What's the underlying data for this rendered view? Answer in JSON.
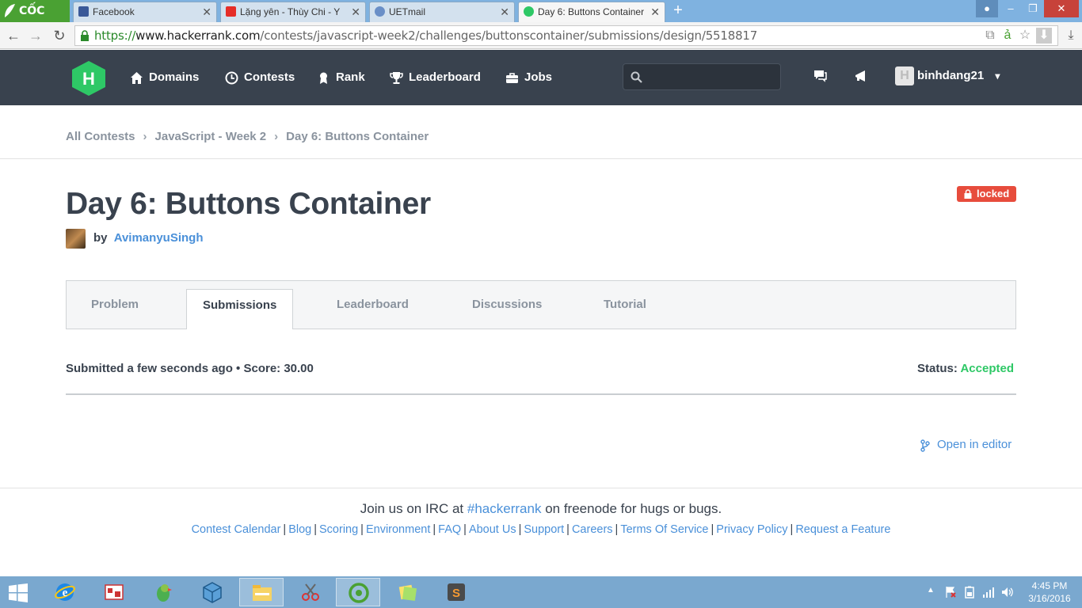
{
  "browser": {
    "brand": "CỐC CỐC",
    "tabs": [
      {
        "title": "Facebook",
        "icon": "facebook-icon"
      },
      {
        "title": "Lặng yên - Thùy Chi - Y",
        "icon": "youtube-icon"
      },
      {
        "title": "UETmail",
        "icon": "mail-icon"
      },
      {
        "title": "Day 6: Buttons Container",
        "icon": "hackerrank-icon",
        "active": true
      }
    ],
    "url_scheme": "https://",
    "url_host": "www.hackerrank.com",
    "url_path": "/contests/javascript-week2/challenges/buttonscontainer/submissions/design/5518817"
  },
  "nav": {
    "items": [
      {
        "label": "Domains",
        "icon": "home-icon"
      },
      {
        "label": "Contests",
        "icon": "clock-icon"
      },
      {
        "label": "Rank",
        "icon": "medal-icon"
      },
      {
        "label": "Leaderboard",
        "icon": "trophy-icon"
      },
      {
        "label": "Jobs",
        "icon": "briefcase-icon"
      }
    ],
    "search_placeholder": "",
    "username": "binhdang21"
  },
  "breadcrumb": [
    "All Contests",
    "JavaScript - Week 2",
    "Day 6: Buttons Container"
  ],
  "challenge": {
    "title": "Day 6: Buttons Container",
    "by": "by",
    "author": "AvimanyuSingh",
    "badge": "locked"
  },
  "tabs": [
    "Problem",
    "Submissions",
    "Leaderboard",
    "Discussions",
    "Tutorial"
  ],
  "active_tab": "Submissions",
  "submission": {
    "submitted": "Submitted a few seconds ago",
    "score_label": "Score: 30.00",
    "status_label": "Status:",
    "status_value": "Accepted",
    "open_editor": "Open in editor"
  },
  "footer": {
    "irc_pre": "Join us on IRC at",
    "irc_channel": "#hackerrank",
    "irc_post": "on freenode for hugs or bugs.",
    "links": [
      "Contest Calendar",
      "Blog",
      "Scoring",
      "Environment",
      "FAQ",
      "About Us",
      "Support",
      "Careers",
      "Terms Of Service",
      "Privacy Policy",
      "Request a Feature"
    ]
  },
  "taskbar": {
    "time": "4:45 PM",
    "date": "3/16/2016"
  },
  "colors": {
    "nav_bg": "#39424e",
    "brand_green": "#2ec866",
    "link_blue": "#4a90d9",
    "locked_red": "#e74c3c"
  }
}
